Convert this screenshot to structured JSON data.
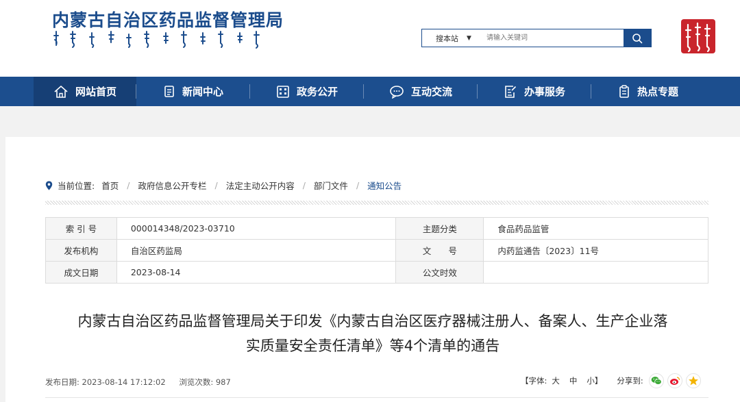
{
  "header": {
    "site_title": "内蒙古自治区药品监督管理局",
    "search": {
      "scope_label": "搜本站",
      "placeholder": "请输入关键词"
    }
  },
  "nav": {
    "items": [
      {
        "label": "网站首页",
        "icon": "home-icon"
      },
      {
        "label": "新闻中心",
        "icon": "news-icon"
      },
      {
        "label": "政务公开",
        "icon": "building-icon"
      },
      {
        "label": "互动交流",
        "icon": "chat-icon"
      },
      {
        "label": "办事服务",
        "icon": "edit-doc-icon"
      },
      {
        "label": "热点专题",
        "icon": "report-icon"
      }
    ]
  },
  "breadcrumb": {
    "prefix": "当前位置:",
    "items": [
      "首页",
      "政府信息公开专栏",
      "法定主动公开内容",
      "部门文件",
      "通知公告"
    ]
  },
  "meta": {
    "index_label": "索 引 号",
    "index_value": "000014348/2023-03710",
    "topic_label": "主题分类",
    "topic_value": "食品药品监管",
    "publisher_label": "发布机构",
    "publisher_value": "自治区药监局",
    "docno_label": "文　　号",
    "docno_value": "内药监通告〔2023〕11号",
    "date_label": "成文日期",
    "date_value": "2023-08-14",
    "validity_label": "公文时效",
    "validity_value": ""
  },
  "article": {
    "title_line1": "内蒙古自治区药品监督管理局关于印发《内蒙古自治区医疗器械注册人、备案人、生产企业落",
    "title_line2": "实质量安全责任清单》等4个清单的通告",
    "publish_date": "发布日期:  2023-08-14 17:12:02",
    "views": "浏览次数:  987"
  },
  "tools": {
    "font_prefix": "【字体:",
    "font_large": "大",
    "font_medium": "中",
    "font_small": "小】",
    "share_label": "分享到:",
    "colors": {
      "wechat": "#3aa935",
      "weibo": "#e6162d",
      "qzone": "#f3b400"
    }
  },
  "theme": {
    "brand_blue": "#1b4c8c",
    "seal_red": "#c9252c"
  }
}
